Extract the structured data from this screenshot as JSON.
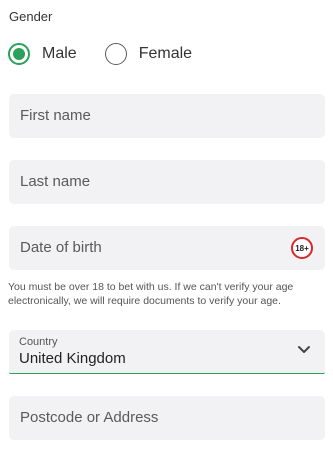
{
  "gender": {
    "label": "Gender",
    "options": [
      {
        "label": "Male",
        "selected": true
      },
      {
        "label": "Female",
        "selected": false
      }
    ]
  },
  "fields": {
    "first_name": {
      "placeholder": "First name",
      "value": ""
    },
    "last_name": {
      "placeholder": "Last name",
      "value": ""
    },
    "dob": {
      "placeholder": "Date of birth",
      "value": "",
      "badge": "18+"
    },
    "dob_helper": "You must be over 18 to bet with us. If we can't verify your age electronically, we will require documents to verify your age.",
    "country": {
      "label": "Country",
      "value": "United Kingdom",
      "icon": "chevron-down-icon"
    },
    "postcode": {
      "placeholder": "Postcode or Address",
      "value": ""
    }
  },
  "colors": {
    "accent": "#2aa05a",
    "field_bg": "#f2f2f4",
    "badge_red": "#d8282f"
  }
}
